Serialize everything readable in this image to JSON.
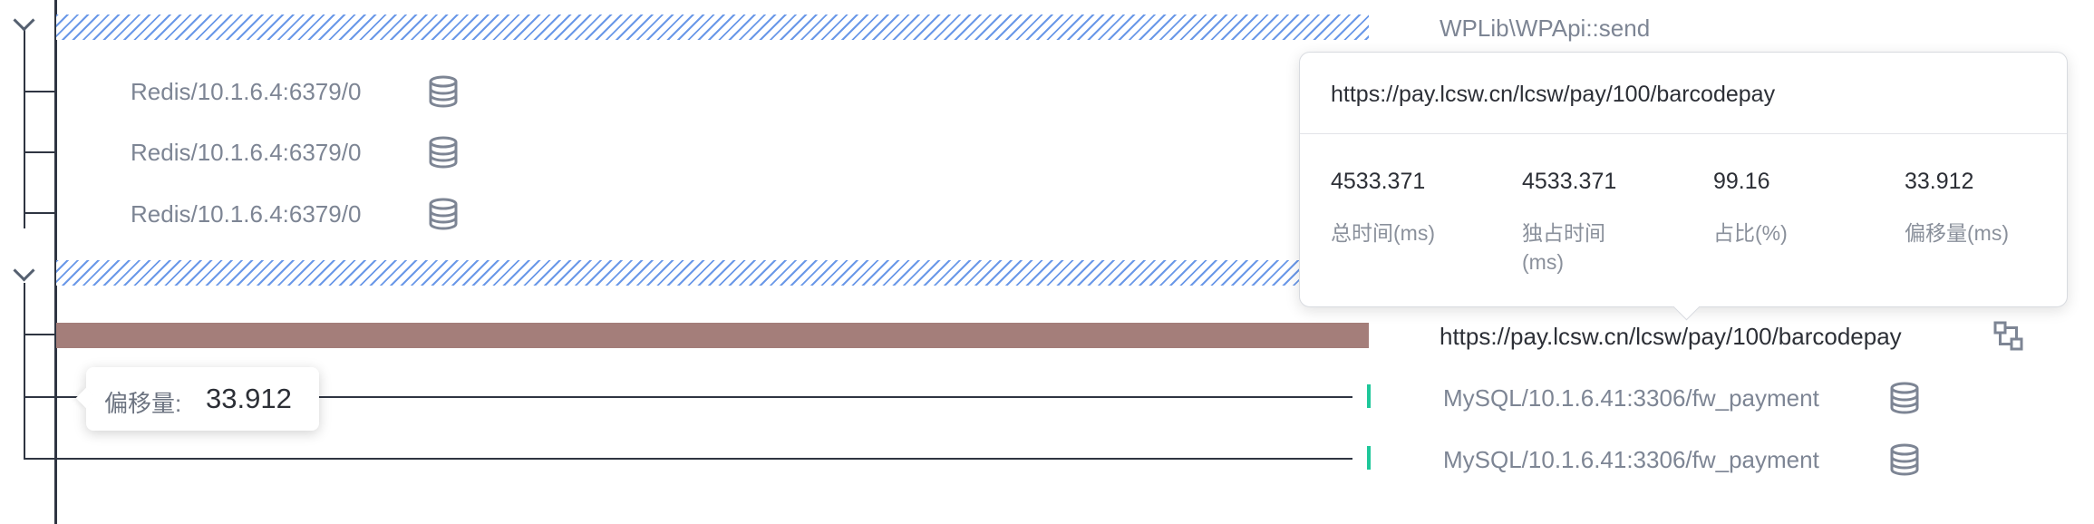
{
  "rows": {
    "wplib_send": "WPLib\\WPApi::send",
    "redis_1": "Redis/10.1.6.4:6379/0",
    "redis_2": "Redis/10.1.6.4:6379/0",
    "redis_3": "Redis/10.1.6.4:6379/0",
    "barcodepay": "https://pay.lcsw.cn/lcsw/pay/100/barcodepay",
    "mysql_1": "MySQL/10.1.6.41:3306/fw_payment",
    "mysql_2": "MySQL/10.1.6.41:3306/fw_payment"
  },
  "detail_tooltip": {
    "url": "https://pay.lcsw.cn/lcsw/pay/100/barcodepay",
    "total_time_value": "4533.371",
    "self_time_value": "4533.371",
    "ratio_value": "99.16",
    "offset_value": "33.912",
    "total_time_label": "总时间(ms)",
    "self_time_label": "独占时间(ms)",
    "ratio_label": "占比(%)",
    "offset_label": "偏移量(ms)"
  },
  "offset_tooltip": {
    "label": "偏移量:",
    "value": "33.912"
  },
  "colors": {
    "hatch": "#6a98e8",
    "http_bar": "#a47e7a",
    "tick": "#1ec79a",
    "tree_line": "#2f3542"
  },
  "icons": [
    "chevron-down-icon",
    "database-icon",
    "topology-icon"
  ]
}
